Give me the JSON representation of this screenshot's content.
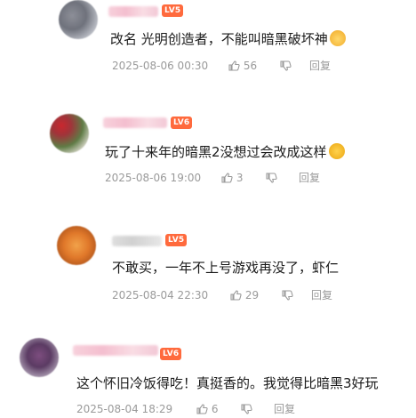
{
  "comments": [
    {
      "level": "LV5",
      "text": "改名 光明创造者，不能叫暗黑破坏神",
      "emoji": "cat-face-emoji",
      "time": "2025-08-06 00:30",
      "likes": "56",
      "reply": "回复"
    },
    {
      "level": "LV6",
      "text": "玩了十来年的暗黑2没想过会改成这样",
      "emoji": "ok-hand-emoji",
      "time": "2025-08-06 19:00",
      "likes": "3",
      "reply": "回复"
    },
    {
      "level": "LV5",
      "text": "不敢买，一年不上号游戏再没了，虾仁",
      "time": "2025-08-04 22:30",
      "likes": "29",
      "reply": "回复"
    },
    {
      "level": "LV6",
      "text": "这个怀旧冷饭得吃！真挺香的。我觉得比暗黑3好玩",
      "time": "2025-08-04 18:29",
      "likes": "6",
      "reply": "回复"
    }
  ],
  "colors": {
    "level_badge": "#ff6a3d",
    "meta_text": "#9a9a9a",
    "username_blur": "#f3b4c7"
  }
}
